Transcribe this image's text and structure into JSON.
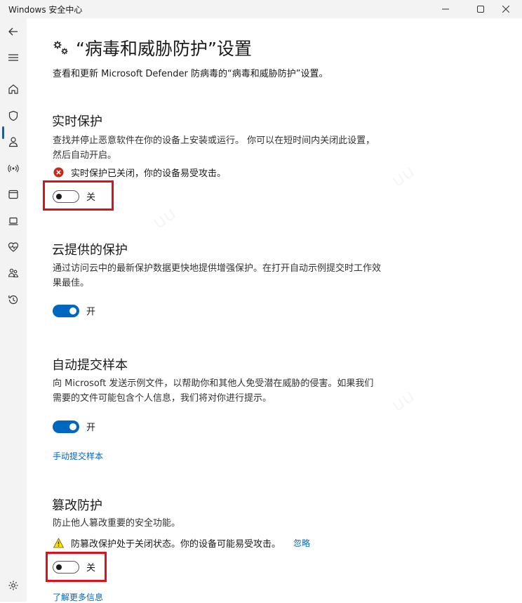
{
  "window": {
    "title": "Windows 安全中心"
  },
  "header": {
    "title": "“病毒和威胁防护”设置",
    "description": "查看和更新 Microsoft Defender 防病毒的“病毒和威胁防护”设置。"
  },
  "sections": {
    "realtime": {
      "title": "实时保护",
      "description": "查找并停止恶意软件在你的设备上安装或运行。 你可以在短时间内关闭此设置，然后自动开启。",
      "status": "实时保护已关闭，你的设备易受攻击。",
      "toggle_label": "关",
      "toggle_state": "off"
    },
    "cloud": {
      "title": "云提供的保护",
      "description": "通过访问云中的最新保护数据更快地提供增强保护。在打开自动示例提交时工作效果最佳。",
      "toggle_label": "开",
      "toggle_state": "on"
    },
    "sample": {
      "title": "自动提交样本",
      "description": "向 Microsoft 发送示例文件，以帮助你和其他人免受潜在威胁的侵害。如果我们需要的文件可能包含个人信息，我们将对你进行提示。",
      "toggle_label": "开",
      "toggle_state": "on",
      "link": "手动提交样本"
    },
    "tamper": {
      "title": "篡改防护",
      "description": "防止他人篡改重要的安全功能。",
      "status": "防篡改保护处于关闭状态。你的设备可能易受攻击。",
      "dismiss": "忽略",
      "toggle_label": "关",
      "toggle_state": "off",
      "link": "了解更多信息"
    }
  },
  "colors": {
    "accent": "#0067c0",
    "error": "#c42b1c",
    "warning": "#fce100",
    "highlight": "#e0101a"
  },
  "sidebar_icons": [
    "back-arrow-icon",
    "hamburger-icon",
    "home-icon",
    "shield-icon",
    "account-icon",
    "firewall-icon",
    "app-browser-icon",
    "device-icon",
    "health-icon",
    "family-icon",
    "history-icon",
    "settings-icon"
  ]
}
